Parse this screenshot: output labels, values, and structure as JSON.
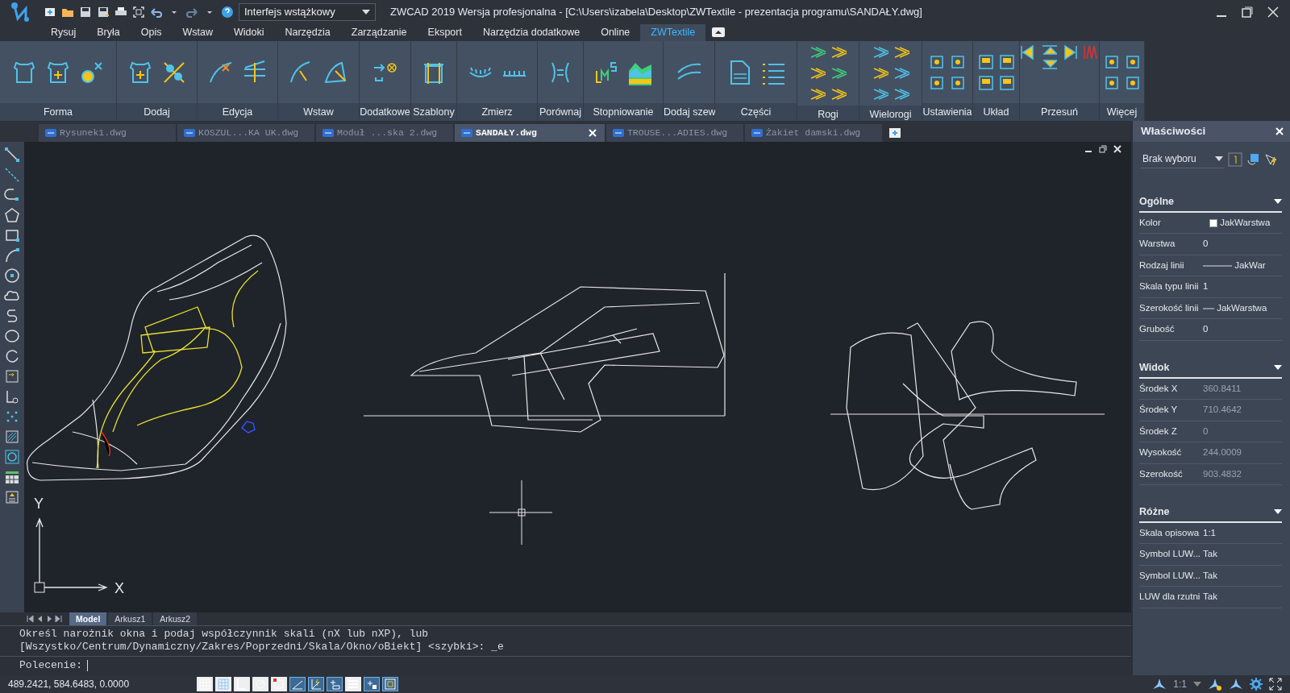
{
  "title_bar": {
    "workspace": "Interfejs wstążkowy",
    "title": "ZWCAD 2019 Wersja profesjonalna - [C:\\Users\\izabela\\Desktop\\ZWTextile - prezentacja programu\\SANDAŁY.dwg]"
  },
  "menu_tabs": [
    {
      "label": "Rysuj",
      "selected": false
    },
    {
      "label": "Bryła",
      "selected": false
    },
    {
      "label": "Opis",
      "selected": false
    },
    {
      "label": "Wstaw",
      "selected": false
    },
    {
      "label": "Widoki",
      "selected": false
    },
    {
      "label": "Narzędzia",
      "selected": false
    },
    {
      "label": "Zarządzanie",
      "selected": false
    },
    {
      "label": "Eksport",
      "selected": false
    },
    {
      "label": "Narzędzia dodatkowe",
      "selected": false
    },
    {
      "label": "Online",
      "selected": false
    },
    {
      "label": "ZWTextile",
      "selected": true
    }
  ],
  "ribbon_panels": [
    {
      "label": "Forma"
    },
    {
      "label": "Dodaj"
    },
    {
      "label": "Edycja"
    },
    {
      "label": "Wstaw"
    },
    {
      "label": "Dodatkowe"
    },
    {
      "label": "Szablony"
    },
    {
      "label": "Zmierz"
    },
    {
      "label": "Porównaj"
    },
    {
      "label": "Stopniowanie"
    },
    {
      "label": "Dodaj szew"
    },
    {
      "label": "Części"
    },
    {
      "label": "Rogi"
    },
    {
      "label": "Wielorogi"
    },
    {
      "label": "Ustawienia"
    },
    {
      "label": "Układ"
    },
    {
      "label": "Przesuń"
    },
    {
      "label": "Więcej"
    }
  ],
  "document_tabs": [
    {
      "label": "Rysunek1.dwg",
      "selected": false
    },
    {
      "label": "KOSZUL...KA UK.dwg",
      "selected": false
    },
    {
      "label": "Moduł ...ska 2.dwg",
      "selected": false
    },
    {
      "label": "SANDAŁY.dwg",
      "selected": true
    },
    {
      "label": "TROUSE...ADIES.dwg",
      "selected": false
    },
    {
      "label": "Żakiet damski.dwg",
      "selected": false
    }
  ],
  "drawing": {
    "axis_x": "X",
    "axis_y": "Y"
  },
  "layout_tabs": [
    {
      "label": "Model",
      "selected": true
    },
    {
      "label": "Arkusz1",
      "selected": false
    },
    {
      "label": "Arkusz2",
      "selected": false
    }
  ],
  "command_line": {
    "history": [
      "Określ narożnik okna i podaj współczynnik skali (nX lub nXP), lub",
      "[Wszystko/Centrum/Dynamiczny/Zakres/Poprzedni/Skala/Okno/oBiekt] <szybki>: _e"
    ],
    "prompt": "Polecenie:"
  },
  "status_bar": {
    "coordinates": "489.2421, 584.6483, 0.0000",
    "toggles": [
      {
        "on": false
      },
      {
        "on": false
      },
      {
        "on": false
      },
      {
        "on": false
      },
      {
        "on": false
      },
      {
        "on": true
      },
      {
        "on": true
      },
      {
        "on": true
      },
      {
        "on": false
      },
      {
        "on": true
      },
      {
        "on": true
      }
    ],
    "annotation_scale": "1:1"
  },
  "properties": {
    "title": "Właściwości",
    "selection": "Brak wyboru",
    "sections": [
      {
        "title": "Ogólne",
        "rows": [
          {
            "kind": "color",
            "label": "Kolor",
            "value": "JakWarstwa"
          },
          {
            "kind": "text",
            "label": "Warstwa",
            "value": "0"
          },
          {
            "kind": "line",
            "label": "Rodzaj linii",
            "value": "JakWar"
          },
          {
            "kind": "text",
            "label": "Skala typu linii",
            "value": "1"
          },
          {
            "kind": "line",
            "label": "Szerokość linii",
            "value": "JakWarstwa"
          },
          {
            "kind": "text",
            "label": "Grubość",
            "value": "0"
          }
        ]
      },
      {
        "title": "Widok",
        "rows": [
          {
            "kind": "readonly",
            "label": "Środek X",
            "value": "360.8411"
          },
          {
            "kind": "readonly",
            "label": "Środek Y",
            "value": "710.4642"
          },
          {
            "kind": "readonly",
            "label": "Środek Z",
            "value": "0"
          },
          {
            "kind": "readonly",
            "label": "Wysokość",
            "value": "244.0009"
          },
          {
            "kind": "readonly",
            "label": "Szerokość",
            "value": "903.4832"
          }
        ]
      },
      {
        "title": "Różne",
        "rows": [
          {
            "kind": "text",
            "label": "Skala opisowa",
            "value": "1:1"
          },
          {
            "kind": "text",
            "label": "Symbol LUW...",
            "value": "Tak"
          },
          {
            "kind": "text",
            "label": "Symbol LUW...",
            "value": "Tak"
          },
          {
            "kind": "text",
            "label": "LUW dla rzutni",
            "value": "Tak"
          }
        ]
      }
    ]
  }
}
